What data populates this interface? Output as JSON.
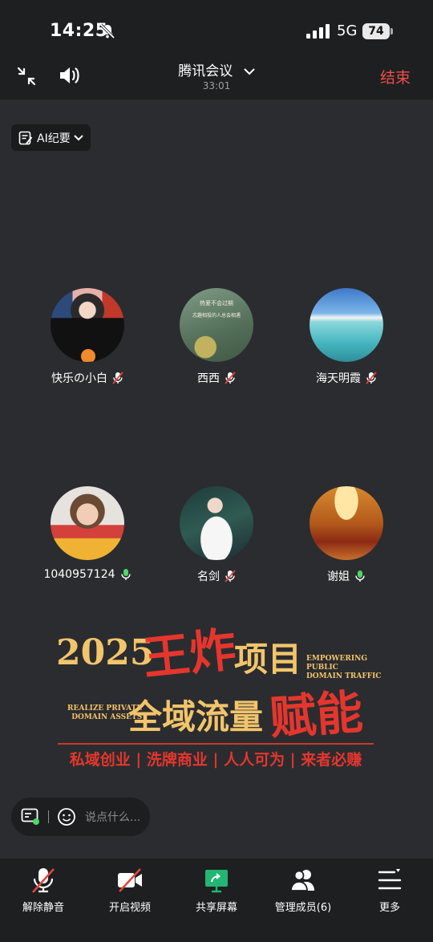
{
  "status_bar": {
    "time": "14:25",
    "network": "5G",
    "battery": "74"
  },
  "header": {
    "title": "腾讯会议",
    "duration": "33:01",
    "end_label": "结束"
  },
  "ai_summary": {
    "label": "AI纪要"
  },
  "participants": [
    {
      "name": "快乐の小白",
      "mic": "muted",
      "host": true
    },
    {
      "name": "西西",
      "mic": "muted"
    },
    {
      "name": "海天明霞",
      "mic": "muted"
    },
    {
      "name": "1040957124",
      "mic": "on"
    },
    {
      "name": "名剑",
      "mic": "muted"
    },
    {
      "name": "谢姐",
      "mic": "on"
    }
  ],
  "avatar_texts": {
    "xixi_line1": "热爱不会过期",
    "xixi_line2": "志趣相投的人总会相遇"
  },
  "banner": {
    "year": "2025",
    "big1": "王炸",
    "project": "项目",
    "en_right_1": "EMPOWERING PUBLIC",
    "en_right_2": "DOMAIN TRAFFIC",
    "en_left_1": "REALIZE PRIVATE",
    "en_left_2": "DOMAIN ASSETS",
    "flow": "全域流量",
    "big2": "赋能",
    "slogan": "私域创业 | 洗牌商业 | 人人可为 | 来者必赚"
  },
  "chat": {
    "placeholder": "说点什么..."
  },
  "toolbar": {
    "unmute": "解除静音",
    "video": "开启视频",
    "share": "共享屏幕",
    "members": "管理成员(6)",
    "more": "更多"
  },
  "colors": {
    "accent_red": "#f04d4d",
    "share_green": "#22b573",
    "mic_green": "#4cd964",
    "banner_gold": "#f2c46b",
    "banner_red": "#e5362e"
  }
}
